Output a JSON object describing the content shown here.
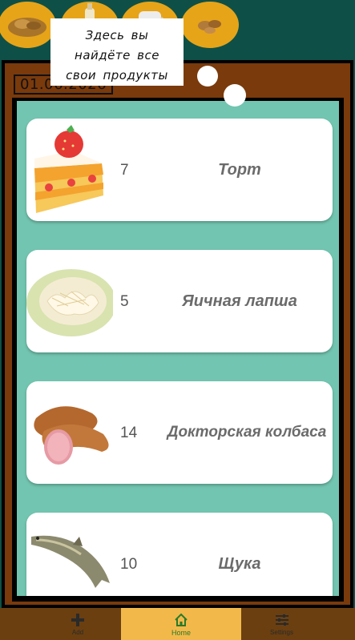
{
  "tooltip": {
    "lines": [
      "Здесь вы",
      "найдёте все",
      "свои продукты"
    ]
  },
  "header": {
    "date": "01.06.2026",
    "categories": [
      {
        "icon": "grains-category-icon"
      },
      {
        "icon": "bottle-category-icon"
      },
      {
        "icon": "jug-category-icon"
      },
      {
        "icon": "nuts-category-icon"
      }
    ]
  },
  "products": [
    {
      "name": "Торт",
      "qty": "7",
      "icon": "cake-slice-icon"
    },
    {
      "name": "Яичная лапша",
      "qty": "5",
      "icon": "egg-noodles-icon"
    },
    {
      "name": "Докторская колбаса",
      "qty": "14",
      "icon": "sausage-icon"
    },
    {
      "name": "Щука",
      "qty": "10",
      "icon": "pike-fish-icon"
    }
  ],
  "nav": {
    "add": "Add",
    "home": "Home",
    "settings": "Settings"
  },
  "colors": {
    "teal_dark": "#0e5047",
    "teal_list": "#72c5b0",
    "brown_frame": "#7a3a0c",
    "orange_category": "#e6a419",
    "nav_active": "#f2b94a",
    "nav_bg": "#6b3f10"
  }
}
